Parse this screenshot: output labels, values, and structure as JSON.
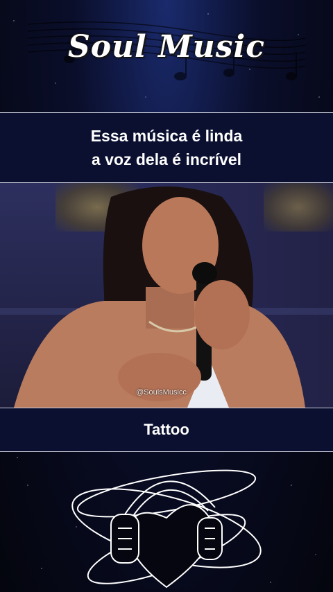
{
  "header": {
    "brand_title": "Soul Music"
  },
  "caption": {
    "line1": "Essa música é linda",
    "line2": "a voz dela é incrível"
  },
  "video": {
    "watermark": "@SoulsMusicc"
  },
  "song": {
    "title": "Tattoo"
  },
  "colors": {
    "background": "#05060f",
    "band": "#0b1030",
    "divider": "#c9cbd8",
    "text": "#ffffff"
  },
  "icons": [
    "music-staff-icon",
    "headphones-heart-icon"
  ]
}
